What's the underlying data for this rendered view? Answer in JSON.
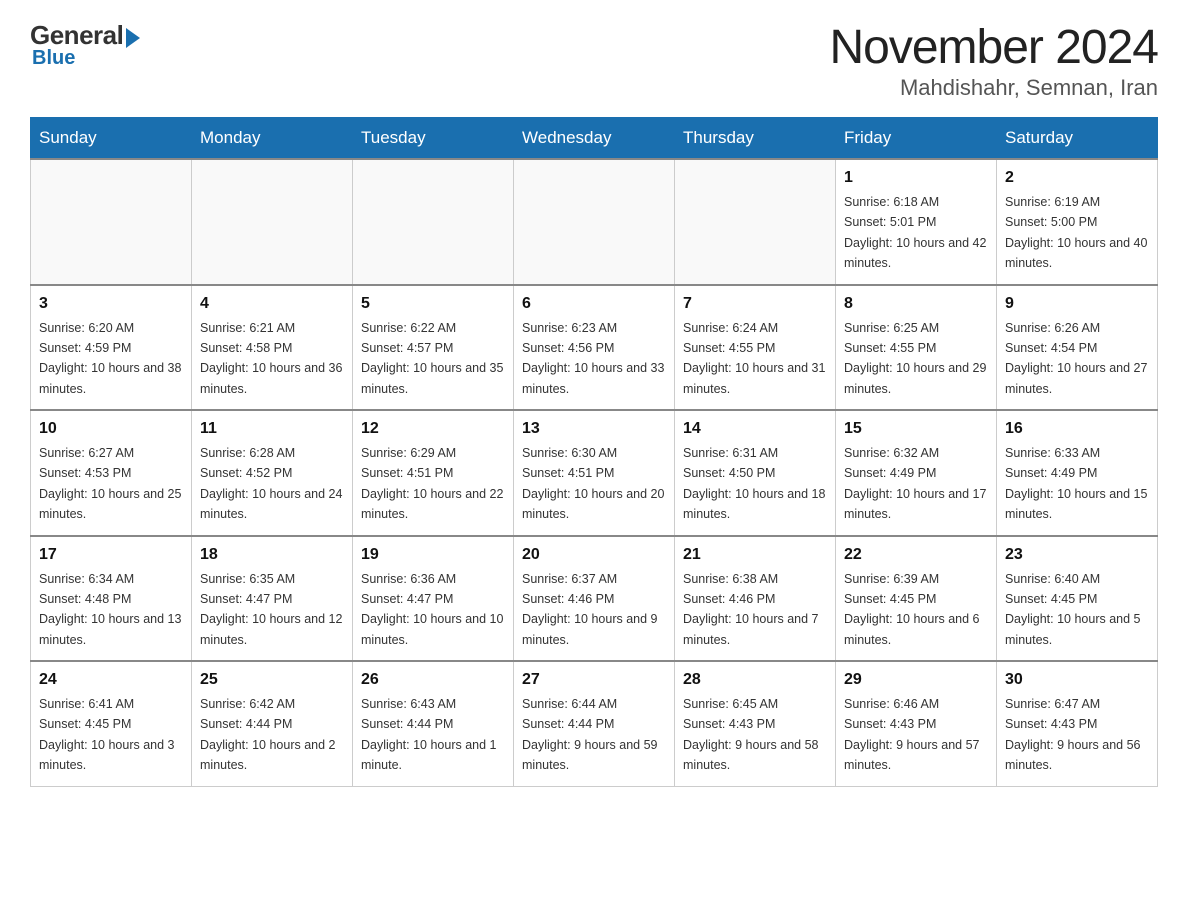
{
  "header": {
    "logo_general": "General",
    "logo_blue": "Blue",
    "month_year": "November 2024",
    "location": "Mahdishahr, Semnan, Iran"
  },
  "weekdays": [
    "Sunday",
    "Monday",
    "Tuesday",
    "Wednesday",
    "Thursday",
    "Friday",
    "Saturday"
  ],
  "weeks": [
    [
      {
        "day": "",
        "info": ""
      },
      {
        "day": "",
        "info": ""
      },
      {
        "day": "",
        "info": ""
      },
      {
        "day": "",
        "info": ""
      },
      {
        "day": "",
        "info": ""
      },
      {
        "day": "1",
        "info": "Sunrise: 6:18 AM\nSunset: 5:01 PM\nDaylight: 10 hours and 42 minutes."
      },
      {
        "day": "2",
        "info": "Sunrise: 6:19 AM\nSunset: 5:00 PM\nDaylight: 10 hours and 40 minutes."
      }
    ],
    [
      {
        "day": "3",
        "info": "Sunrise: 6:20 AM\nSunset: 4:59 PM\nDaylight: 10 hours and 38 minutes."
      },
      {
        "day": "4",
        "info": "Sunrise: 6:21 AM\nSunset: 4:58 PM\nDaylight: 10 hours and 36 minutes."
      },
      {
        "day": "5",
        "info": "Sunrise: 6:22 AM\nSunset: 4:57 PM\nDaylight: 10 hours and 35 minutes."
      },
      {
        "day": "6",
        "info": "Sunrise: 6:23 AM\nSunset: 4:56 PM\nDaylight: 10 hours and 33 minutes."
      },
      {
        "day": "7",
        "info": "Sunrise: 6:24 AM\nSunset: 4:55 PM\nDaylight: 10 hours and 31 minutes."
      },
      {
        "day": "8",
        "info": "Sunrise: 6:25 AM\nSunset: 4:55 PM\nDaylight: 10 hours and 29 minutes."
      },
      {
        "day": "9",
        "info": "Sunrise: 6:26 AM\nSunset: 4:54 PM\nDaylight: 10 hours and 27 minutes."
      }
    ],
    [
      {
        "day": "10",
        "info": "Sunrise: 6:27 AM\nSunset: 4:53 PM\nDaylight: 10 hours and 25 minutes."
      },
      {
        "day": "11",
        "info": "Sunrise: 6:28 AM\nSunset: 4:52 PM\nDaylight: 10 hours and 24 minutes."
      },
      {
        "day": "12",
        "info": "Sunrise: 6:29 AM\nSunset: 4:51 PM\nDaylight: 10 hours and 22 minutes."
      },
      {
        "day": "13",
        "info": "Sunrise: 6:30 AM\nSunset: 4:51 PM\nDaylight: 10 hours and 20 minutes."
      },
      {
        "day": "14",
        "info": "Sunrise: 6:31 AM\nSunset: 4:50 PM\nDaylight: 10 hours and 18 minutes."
      },
      {
        "day": "15",
        "info": "Sunrise: 6:32 AM\nSunset: 4:49 PM\nDaylight: 10 hours and 17 minutes."
      },
      {
        "day": "16",
        "info": "Sunrise: 6:33 AM\nSunset: 4:49 PM\nDaylight: 10 hours and 15 minutes."
      }
    ],
    [
      {
        "day": "17",
        "info": "Sunrise: 6:34 AM\nSunset: 4:48 PM\nDaylight: 10 hours and 13 minutes."
      },
      {
        "day": "18",
        "info": "Sunrise: 6:35 AM\nSunset: 4:47 PM\nDaylight: 10 hours and 12 minutes."
      },
      {
        "day": "19",
        "info": "Sunrise: 6:36 AM\nSunset: 4:47 PM\nDaylight: 10 hours and 10 minutes."
      },
      {
        "day": "20",
        "info": "Sunrise: 6:37 AM\nSunset: 4:46 PM\nDaylight: 10 hours and 9 minutes."
      },
      {
        "day": "21",
        "info": "Sunrise: 6:38 AM\nSunset: 4:46 PM\nDaylight: 10 hours and 7 minutes."
      },
      {
        "day": "22",
        "info": "Sunrise: 6:39 AM\nSunset: 4:45 PM\nDaylight: 10 hours and 6 minutes."
      },
      {
        "day": "23",
        "info": "Sunrise: 6:40 AM\nSunset: 4:45 PM\nDaylight: 10 hours and 5 minutes."
      }
    ],
    [
      {
        "day": "24",
        "info": "Sunrise: 6:41 AM\nSunset: 4:45 PM\nDaylight: 10 hours and 3 minutes."
      },
      {
        "day": "25",
        "info": "Sunrise: 6:42 AM\nSunset: 4:44 PM\nDaylight: 10 hours and 2 minutes."
      },
      {
        "day": "26",
        "info": "Sunrise: 6:43 AM\nSunset: 4:44 PM\nDaylight: 10 hours and 1 minute."
      },
      {
        "day": "27",
        "info": "Sunrise: 6:44 AM\nSunset: 4:44 PM\nDaylight: 9 hours and 59 minutes."
      },
      {
        "day": "28",
        "info": "Sunrise: 6:45 AM\nSunset: 4:43 PM\nDaylight: 9 hours and 58 minutes."
      },
      {
        "day": "29",
        "info": "Sunrise: 6:46 AM\nSunset: 4:43 PM\nDaylight: 9 hours and 57 minutes."
      },
      {
        "day": "30",
        "info": "Sunrise: 6:47 AM\nSunset: 4:43 PM\nDaylight: 9 hours and 56 minutes."
      }
    ]
  ]
}
